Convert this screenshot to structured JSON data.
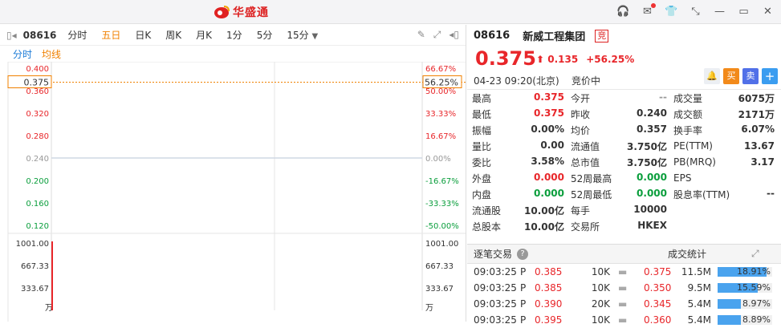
{
  "app": {
    "brand": "华盛通"
  },
  "toolbar": {
    "code": "08616",
    "tabs": [
      "分时",
      "五日",
      "日K",
      "周K",
      "月K",
      "1分",
      "5分",
      "15分"
    ],
    "active_tab": "五日",
    "sub_tabs": [
      "分时",
      "均线"
    ]
  },
  "chart": {
    "price_labels": [
      "0.400",
      "0.360",
      "0.320",
      "0.280",
      "0.240",
      "0.200",
      "0.160",
      "0.120"
    ],
    "pct_labels": [
      "66.67%",
      "50.00%",
      "33.33%",
      "16.67%",
      "0.00%",
      "-16.67%",
      "-33.33%",
      "-50.00%"
    ],
    "current_price": "0.375",
    "current_pct": "56.25%",
    "volume_labels": [
      "1001.00",
      "667.33",
      "333.67",
      "万"
    ],
    "colors": {
      "up": "#e8262a",
      "down": "#0a9e3c",
      "flat": "#999999",
      "current": "#f08000"
    }
  },
  "quote": {
    "code": "08616",
    "name": "新威工程集团",
    "badge": "竞",
    "price": "0.375",
    "change": "0.135",
    "change_pct": "+56.25%",
    "time": "04-23  09:20(北京)",
    "status": "竞价中",
    "buttons": [
      "买",
      "卖",
      "+"
    ]
  },
  "stats": [
    [
      {
        "k": "最高",
        "v": "0.375",
        "c": "red"
      },
      {
        "k": "今开",
        "v": "--",
        "c": "gray"
      },
      {
        "k": "成交量",
        "v": "6075万",
        "c": ""
      }
    ],
    [
      {
        "k": "最低",
        "v": "0.375",
        "c": "red"
      },
      {
        "k": "昨收",
        "v": "0.240",
        "c": ""
      },
      {
        "k": "成交额",
        "v": "2171万",
        "c": ""
      }
    ],
    [
      {
        "k": "振幅",
        "v": "0.00%",
        "c": ""
      },
      {
        "k": "均价",
        "v": "0.357",
        "c": ""
      },
      {
        "k": "换手率",
        "v": "6.07%",
        "c": ""
      }
    ],
    [
      {
        "k": "量比",
        "v": "0.00",
        "c": ""
      },
      {
        "k": "流通值",
        "v": "3.750亿",
        "c": ""
      },
      {
        "k": "PE(TTM)",
        "v": "13.67",
        "c": ""
      }
    ],
    [
      {
        "k": "委比",
        "v": "3.58%",
        "c": ""
      },
      {
        "k": "总市值",
        "v": "3.750亿",
        "c": ""
      },
      {
        "k": "PB(MRQ)",
        "v": "3.17",
        "c": ""
      }
    ],
    [
      {
        "k": "外盘",
        "v": "0.000",
        "c": "red"
      },
      {
        "k": "52周最高",
        "v": "0.000",
        "c": "green"
      },
      {
        "k": "EPS",
        "v": "",
        "c": ""
      }
    ],
    [
      {
        "k": "内盘",
        "v": "0.000",
        "c": "green"
      },
      {
        "k": "52周最低",
        "v": "0.000",
        "c": "green"
      },
      {
        "k": "股息率(TTM)",
        "v": "--",
        "c": ""
      }
    ],
    [
      {
        "k": "流通股",
        "v": "10.00亿",
        "c": ""
      },
      {
        "k": "每手",
        "v": "10000",
        "c": ""
      },
      {
        "k": "",
        "v": "",
        "c": ""
      }
    ],
    [
      {
        "k": "总股本",
        "v": "10.00亿",
        "c": ""
      },
      {
        "k": "交易所",
        "v": "HKEX",
        "c": ""
      },
      {
        "k": "",
        "v": "",
        "c": ""
      }
    ]
  ],
  "trades": {
    "tab_ticks": "逐笔交易",
    "tab_stats": "成交统计",
    "ticks": [
      {
        "time": "09:03:25",
        "flag": "P",
        "price": "0.385",
        "vol": "10K"
      },
      {
        "time": "09:03:25",
        "flag": "P",
        "price": "0.385",
        "vol": "10K"
      },
      {
        "time": "09:03:25",
        "flag": "P",
        "price": "0.390",
        "vol": "20K"
      },
      {
        "time": "09:03:25",
        "flag": "P",
        "price": "0.395",
        "vol": "10K"
      }
    ],
    "dist": [
      {
        "price": "0.375",
        "vol": "11.5M",
        "pct": "18.91%",
        "frac": 0.1891
      },
      {
        "price": "0.350",
        "vol": "9.5M",
        "pct": "15.59%",
        "frac": 0.1559
      },
      {
        "price": "0.345",
        "vol": "5.4M",
        "pct": "8.97%",
        "frac": 0.0897
      },
      {
        "price": "0.360",
        "vol": "5.4M",
        "pct": "8.89%",
        "frac": 0.0889
      }
    ]
  }
}
